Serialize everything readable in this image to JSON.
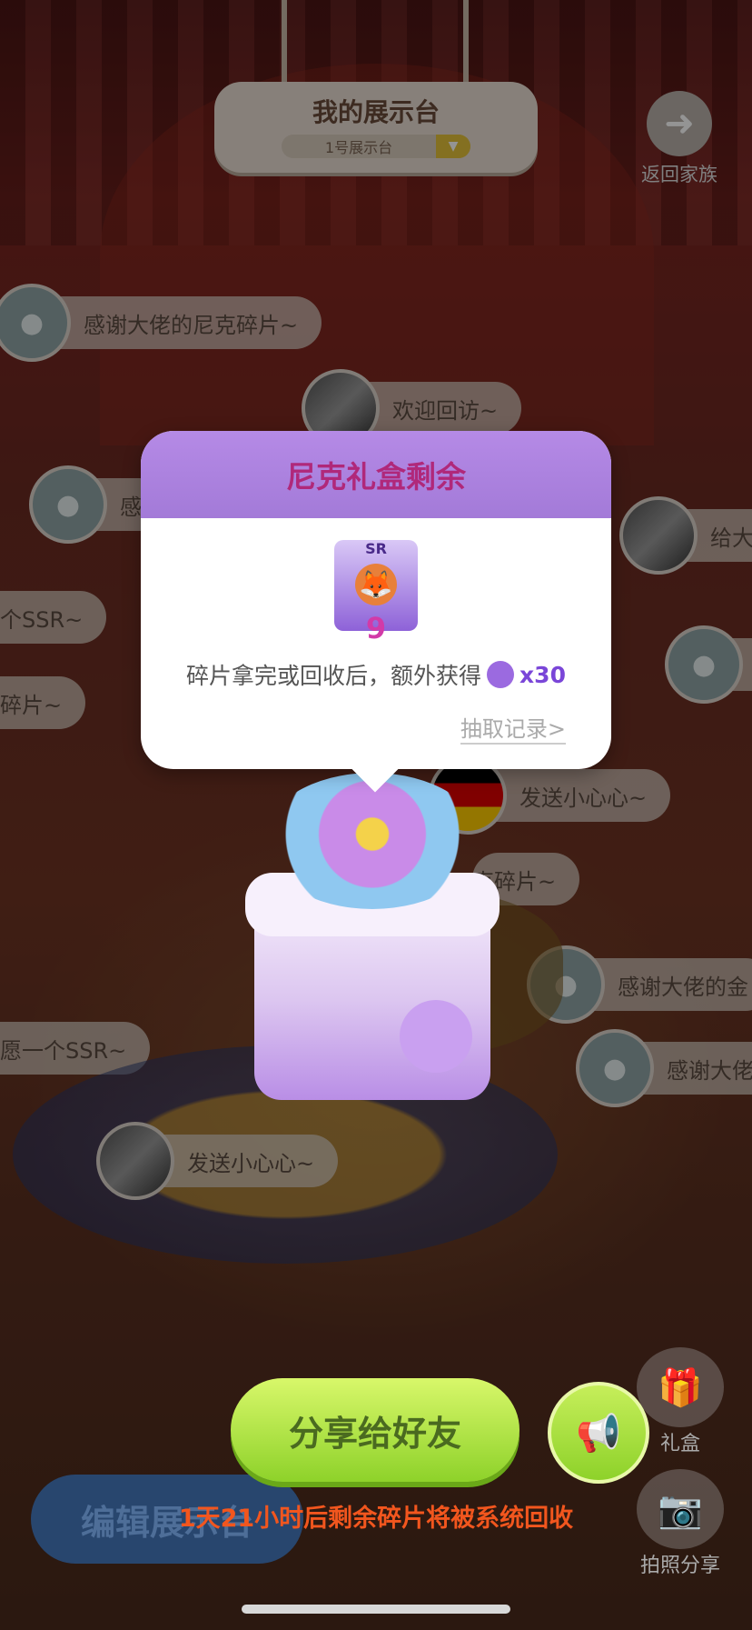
{
  "header": {
    "title": "我的展示台",
    "selector_value": "1号展示台",
    "back_label": "返回家族"
  },
  "bubbles": [
    {
      "text": "感谢大佬的尼克碎片~"
    },
    {
      "text": "欢迎回访~"
    },
    {
      "text": "感"
    },
    {
      "text": "给大"
    },
    {
      "text": "个SSR~"
    },
    {
      "text": "碎片~"
    },
    {
      "text": "发送小心心~"
    },
    {
      "text": "克碎片~"
    },
    {
      "text": "感谢大佬的金"
    },
    {
      "text": "感谢大佬"
    },
    {
      "text": "愿一个SSR~"
    },
    {
      "text": "发送小心心~"
    }
  ],
  "popup": {
    "title": "尼克礼盒剩余",
    "card_rarity": "SR",
    "card_count": "9",
    "desc_text": "碎片拿完或回收后，额外获得",
    "reward_amount": "x30",
    "record_link": "抽取记录>"
  },
  "actions": {
    "share_label": "分享给好友",
    "edit_label": "编辑展示台",
    "giftbox_label": "礼盒",
    "photo_label": "拍照分享"
  },
  "notice": "1天21小时后剩余碎片将被系统回收",
  "colors": {
    "popup_header": "#a37ad8",
    "popup_title": "#b0287a",
    "share_button": "#8ed22a",
    "notice": "#f2561e"
  }
}
